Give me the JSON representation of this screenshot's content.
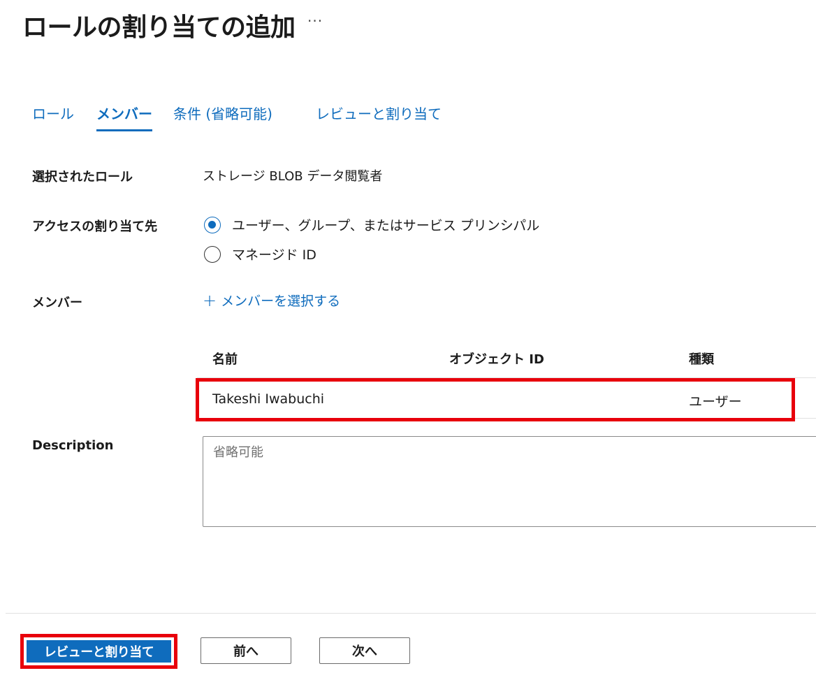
{
  "header": {
    "title": "ロールの割り当ての追加",
    "more_label": "···"
  },
  "tabs": [
    {
      "label": "ロール",
      "active": false
    },
    {
      "label": "メンバー",
      "active": true
    },
    {
      "label": "条件 (省略可能)",
      "active": false
    },
    {
      "label": "レビューと割り当て",
      "active": false
    }
  ],
  "form": {
    "selected_role_label": "選択されたロール",
    "selected_role_value": "ストレージ BLOB データ閲覧者",
    "assign_access_label": "アクセスの割り当て先",
    "assign_options": [
      {
        "label": "ユーザー、グループ、またはサービス プリンシパル",
        "checked": true
      },
      {
        "label": "マネージド ID",
        "checked": false
      }
    ],
    "members_label": "メンバー",
    "add_members_label": "メンバーを選択する",
    "description_label": "Description",
    "description_placeholder": "省略可能",
    "description_value": ""
  },
  "members_table": {
    "columns": [
      "名前",
      "オブジェクト ID",
      "種類"
    ],
    "rows": [
      {
        "name": "Takeshi Iwabuchi",
        "object_id": "",
        "type": "ユーザー"
      }
    ]
  },
  "footer": {
    "review_assign_label": "レビューと割り当て",
    "previous_label": "前へ",
    "next_label": "次へ"
  },
  "colors": {
    "accent": "#0f6cbd",
    "highlight": "#e8000b"
  }
}
